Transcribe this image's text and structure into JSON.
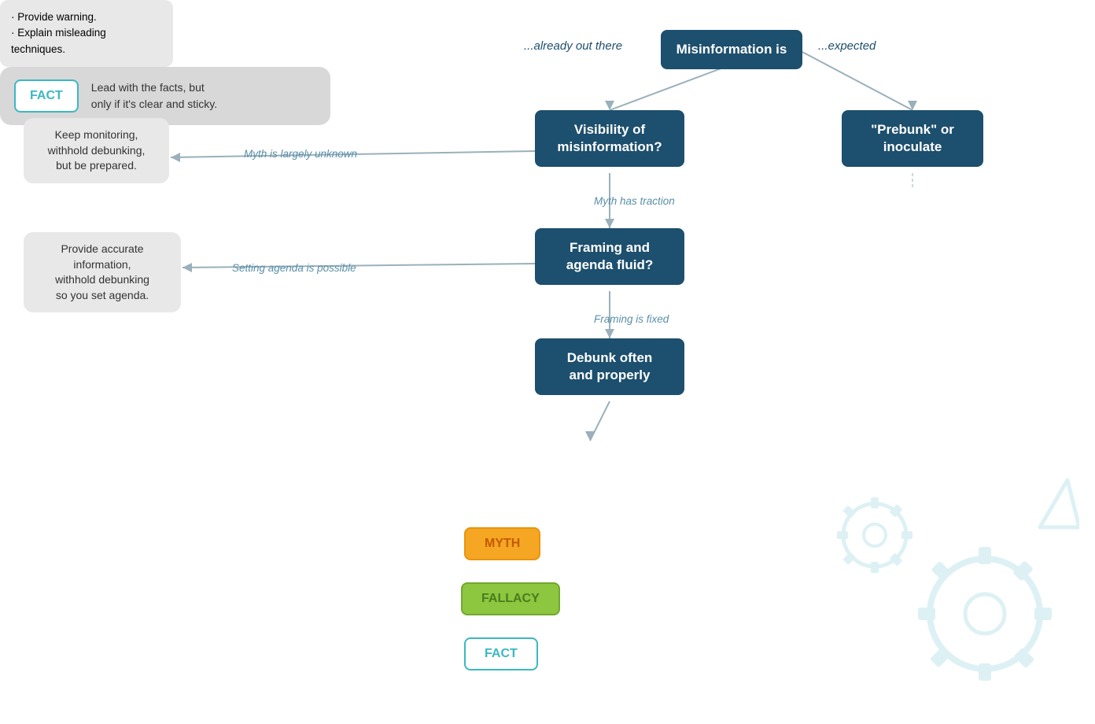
{
  "nodes": {
    "misinfo": {
      "label": "Misinformation is"
    },
    "already": "...already out there",
    "expected": "...expected",
    "visibility": "Visibility of\nmisinformation?",
    "prebunk": "\"Prebunk\" or\ninoculate",
    "prebunk_desc": {
      "line1": "· Provide warning.",
      "line2": "· Explain misleading",
      "line3": "  techniques."
    },
    "keep": "Keep monitoring,\nwithhold debunking,\nbut be prepared.",
    "framing": "Framing and\nagenda fluid?",
    "provide": "Provide accurate\ninformation,\nwithhold debunking\nso you set agenda.",
    "debunk": "Debunk often\nand properly",
    "fact_box": {
      "badge": "FACT",
      "text": "Lead with the facts, but\nonly if it's clear and sticky."
    },
    "badge_myth": "MYTH",
    "badge_fallacy": "FALLACY",
    "badge_fact": "FACT"
  },
  "arrow_labels": {
    "already": "...already out there",
    "expected": "...expected",
    "unknown": "Myth is largely unknown",
    "traction": "Myth has traction",
    "agenda": "Setting agenda is possible",
    "fixed": "Framing is fixed"
  },
  "colors": {
    "dark_teal": "#1d4f6e",
    "light_teal": "#3bb8c3",
    "arrow": "#9ab0bb",
    "myth_bg": "#f5a623",
    "fallacy_bg": "#8dc63f",
    "gear": "#4ab8cc"
  }
}
